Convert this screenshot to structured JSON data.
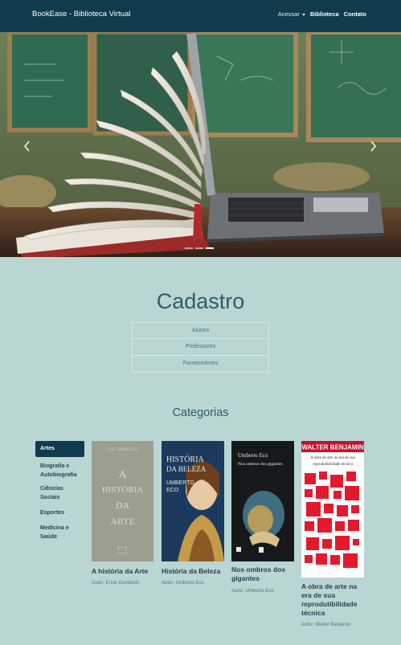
{
  "nav": {
    "brand": "BookEase - Biblioteca Virtual",
    "links": [
      "Acessar",
      "Biblioteca",
      "Contato"
    ]
  },
  "hero": {
    "slides_total": 3,
    "active_slide": 3
  },
  "cadastro": {
    "title": "Cadastro",
    "items": [
      "Alunos",
      "Professores",
      "Fornecedores"
    ]
  },
  "categorias": {
    "title": "Categorias",
    "items": [
      "Artes",
      "Biografia e Autobiografia",
      "Ciências Sociais",
      "Esportes",
      "Medicina e Saúde"
    ],
    "active": "Artes"
  },
  "books": [
    {
      "title": "A história da Arte",
      "author": "Autor: Ernst Gombrich",
      "cover_text": [
        "A",
        "HISTÓRIA",
        "DA",
        "ARTE",
        "E.H. GOMBRICH"
      ]
    },
    {
      "title": "História da Beleza",
      "author": "Autor: Umberto Eco",
      "cover_text": [
        "HISTÓRIA",
        "DA BELEZA",
        "UMBERTO",
        "ECO"
      ]
    },
    {
      "title": "Nos ombros dos gigantes",
      "author": "Autor: Umberto Eco",
      "cover_text": [
        "Umberto Eco",
        "Nos ombros dos gigantes"
      ]
    },
    {
      "title": "A obra de arte na era de sua reprodutibilidade técnica",
      "author": "Autor: Walter Benjamin",
      "cover_text": [
        "WALTER BENJAMIN",
        "A obra de arte na era de sua",
        "reprodutibilidade técnica"
      ]
    }
  ],
  "colors": {
    "navbar": "#0f3b4d",
    "page_bg": "#bad6d2",
    "accent": "#2f5b6a"
  }
}
